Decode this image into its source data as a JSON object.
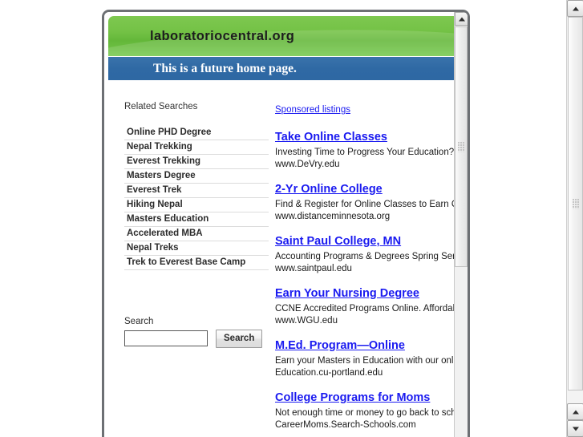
{
  "site": {
    "domain_title": "laboratoriocentral.org",
    "tagline": "This is a future home page."
  },
  "left_column": {
    "related_heading": "Related Searches",
    "related_searches": [
      "Online PHD Degree",
      "Nepal Trekking",
      "Everest Trekking",
      "Masters Degree",
      "Everest Trek",
      "Hiking Nepal",
      "Masters Education",
      "Accelerated MBA",
      "Nepal Treks",
      "Trek to Everest Base Camp"
    ],
    "search": {
      "label": "Search",
      "value": "",
      "placeholder": "",
      "button_label": "Search"
    }
  },
  "right_column": {
    "sponsored_label": "Sponsored listings",
    "ads": [
      {
        "title": "Take Online Classes",
        "description": "Investing Time to Progress Your Education? Ea",
        "url": "www.DeVry.edu"
      },
      {
        "title": "2-Yr Online College",
        "description": "Find & Register for Online Classes to Earn Onli",
        "url": "www.distanceminnesota.org"
      },
      {
        "title": "Saint Paul College, MN",
        "description": "Accounting Programs & Degrees Spring Seme",
        "url": "www.saintpaul.edu"
      },
      {
        "title": "Earn Your Nursing Degree",
        "description": "CCNE Accredited Programs Online. Affordable",
        "url": "www.WGU.edu"
      },
      {
        "title": "M.Ed. Program—Online",
        "description": "Earn your Masters in Education with our online",
        "url": "Education.cu-portland.edu"
      },
      {
        "title": "College Programs for Moms",
        "description": "Not enough time or money to go back to schoo",
        "url": "CareerMoms.Search-Schools.com"
      }
    ]
  },
  "colors": {
    "banner_green": "#74c246",
    "banner_blue": "#2f69a4",
    "link_blue": "#1a1af0",
    "frame_border": "#6d7074"
  }
}
